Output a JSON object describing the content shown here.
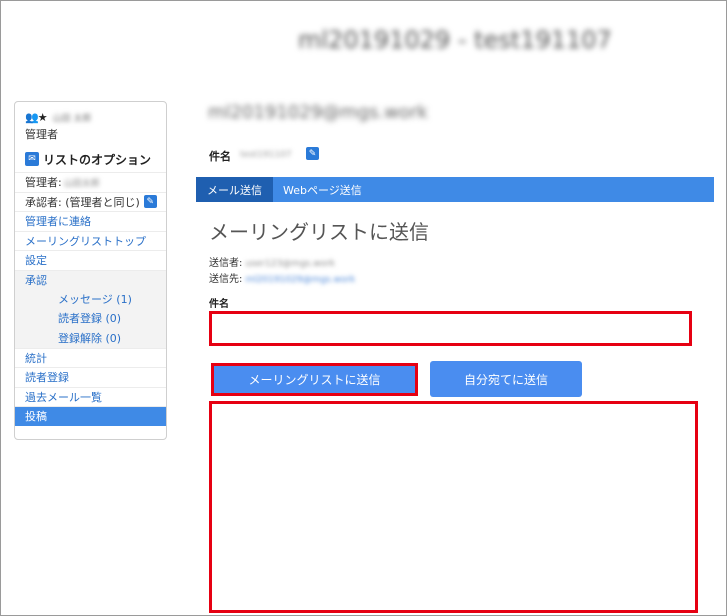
{
  "header": {
    "title": "ml20191029 - test191107"
  },
  "sidebar": {
    "user_icons": "👥★",
    "user_name": "山田 太郎",
    "user_role": "管理者",
    "options_title": "リストのオプション",
    "admin_label": "管理者:",
    "admin_value": "山田太郎",
    "approver_label": "承認者: (管理者と同じ)",
    "contact_admin": "管理者に連絡",
    "items": [
      {
        "label": "メーリングリストトップ"
      },
      {
        "label": "設定"
      },
      {
        "label": "承認"
      },
      {
        "label": "メッセージ (1)"
      },
      {
        "label": "読者登録 (0)"
      },
      {
        "label": "登録解除 (0)"
      },
      {
        "label": "統計"
      },
      {
        "label": "読者登録"
      },
      {
        "label": "過去メール一覧"
      },
      {
        "label": "投稿"
      }
    ]
  },
  "main": {
    "list_address": "ml20191029@mgs.work",
    "subject_label": "件名",
    "subject_value": "test191107",
    "tabs": [
      {
        "label": "メール送信",
        "active": true
      },
      {
        "label": "Webページ送信",
        "active": false
      }
    ],
    "section_title": "メーリングリストに送信",
    "sender_label": "送信者:",
    "sender_value": "user123@mgs.work",
    "recipient_label": "送信先:",
    "recipient_value": "ml20191029@mgs.work",
    "form": {
      "subject_label": "件名",
      "subject_value": "",
      "body_value": "",
      "send_list_label": "メーリングリストに送信",
      "send_self_label": "自分宛てに送信"
    }
  },
  "colors": {
    "accent": "#3f8ae6",
    "active_tab": "#1f5fb0",
    "highlight": "#e60012",
    "link": "#2a70c8"
  }
}
